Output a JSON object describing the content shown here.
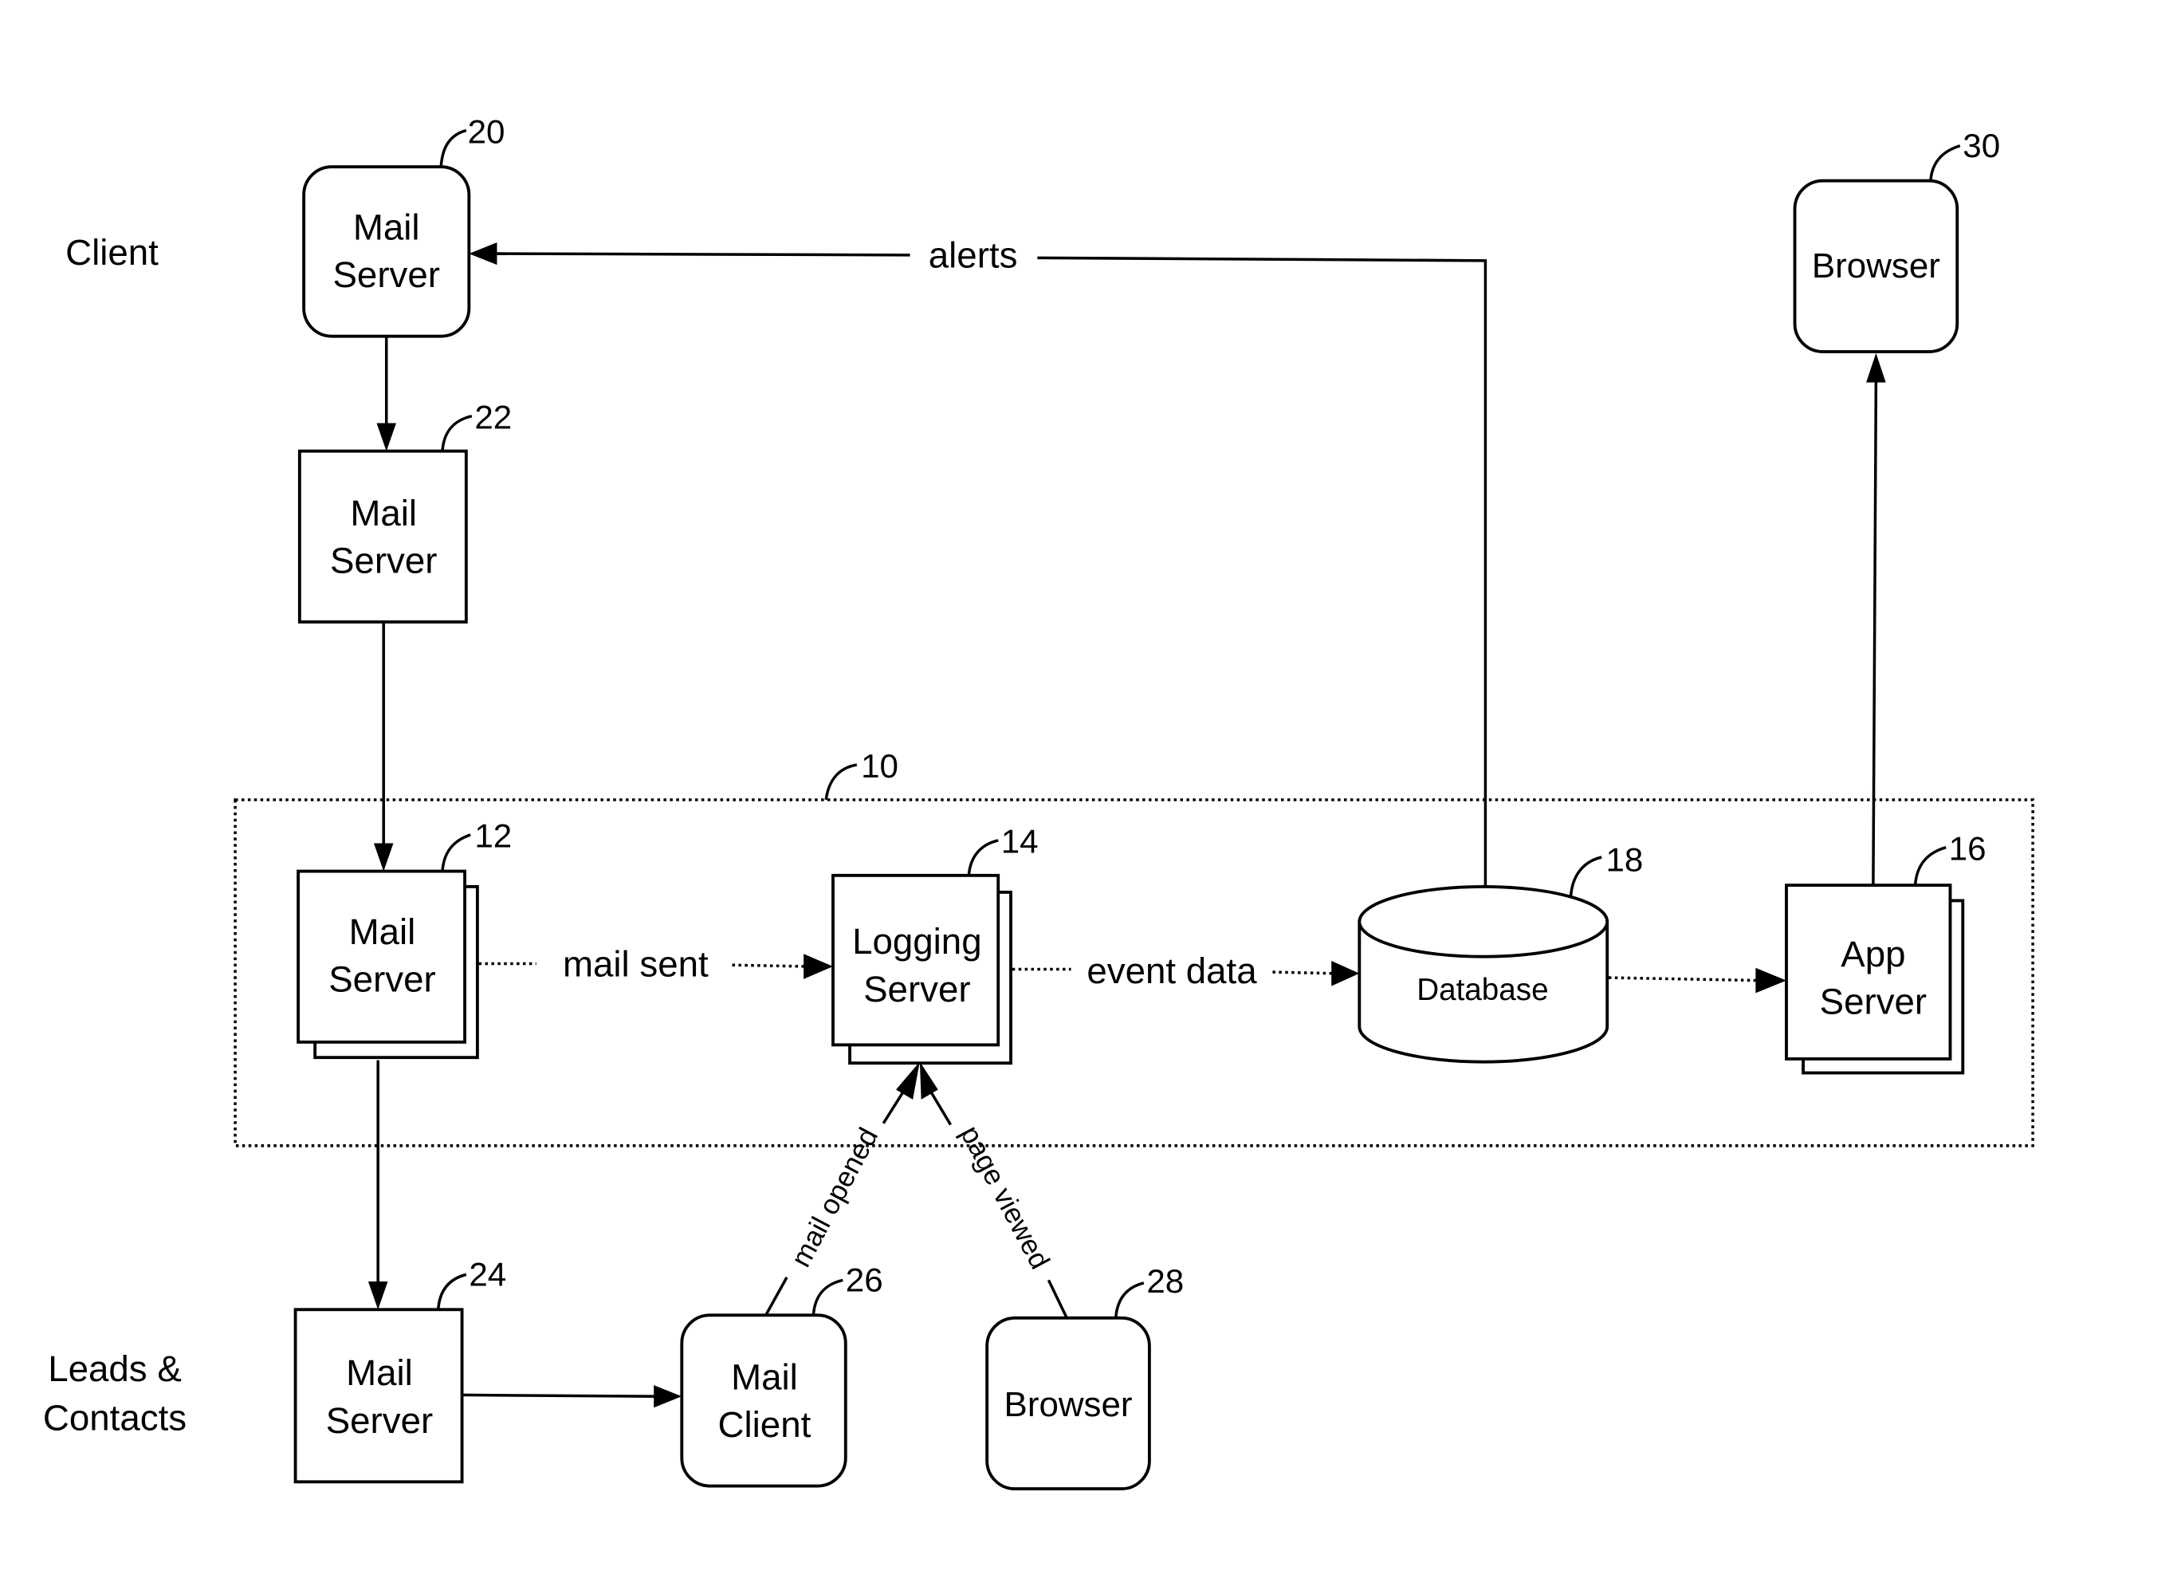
{
  "diagram": {
    "groups": {
      "client": "Client",
      "leads_line1": "Leads &",
      "leads_line2": "Contacts"
    },
    "container": {
      "ref": "10"
    },
    "nodes": {
      "mail_server_20": {
        "ref": "20",
        "line1": "Mail",
        "line2": "Server"
      },
      "mail_server_22": {
        "ref": "22",
        "line1": "Mail",
        "line2": "Server"
      },
      "mail_server_12": {
        "ref": "12",
        "line1": "Mail",
        "line2": "Server"
      },
      "logging_server_14": {
        "ref": "14",
        "line1": "Logging",
        "line2": "Server"
      },
      "database_18": {
        "ref": "18",
        "label": "Database"
      },
      "app_server_16": {
        "ref": "16",
        "line1": "App",
        "line2": "Server"
      },
      "browser_30": {
        "ref": "30",
        "label": "Browser"
      },
      "mail_server_24": {
        "ref": "24",
        "line1": "Mail",
        "line2": "Server"
      },
      "mail_client_26": {
        "ref": "26",
        "line1": "Mail",
        "line2": "Client"
      },
      "browser_28": {
        "ref": "28",
        "label": "Browser"
      }
    },
    "edges": {
      "alerts": "alerts",
      "mail_sent": "mail sent",
      "event_data": "event data",
      "mail_opened": "mail opened",
      "page_viewed": "page viewed"
    }
  }
}
